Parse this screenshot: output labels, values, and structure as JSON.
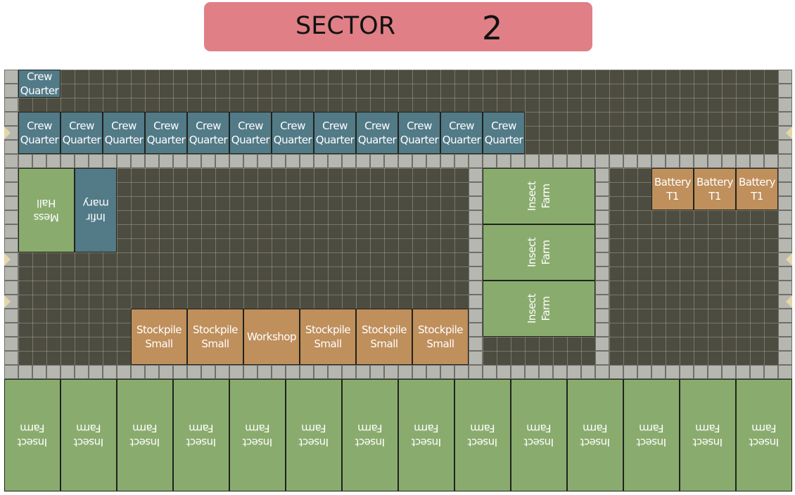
{
  "header": {
    "title": "SECTOR",
    "sector_number": "2",
    "color": "#e07f86"
  },
  "map": {
    "grid_columns": 56,
    "grid_rows": 30,
    "colors": {
      "floor": "#4d4c40",
      "corridor": "#b7b7b1",
      "blue_room": "#527a87",
      "green_room": "#8aab6e",
      "orange_room": "#bf8f5c",
      "marker": "#e6d6a8"
    },
    "rooms": [
      {
        "label": "Crew\nQuarter",
        "type": "crew-quarter",
        "color": "blue",
        "col": 1,
        "row": 0,
        "w": 3,
        "h": 2,
        "rot": 0
      },
      {
        "label": "Crew\nQuarter",
        "type": "crew-quarter",
        "color": "blue",
        "col": 1,
        "row": 3,
        "w": 3,
        "h": 3,
        "rot": 0
      },
      {
        "label": "Crew\nQuarter",
        "type": "crew-quarter",
        "color": "blue",
        "col": 4,
        "row": 3,
        "w": 3,
        "h": 3,
        "rot": 0
      },
      {
        "label": "Crew\nQuarter",
        "type": "crew-quarter",
        "color": "blue",
        "col": 7,
        "row": 3,
        "w": 3,
        "h": 3,
        "rot": 0
      },
      {
        "label": "Crew\nQuarter",
        "type": "crew-quarter",
        "color": "blue",
        "col": 10,
        "row": 3,
        "w": 3,
        "h": 3,
        "rot": 0
      },
      {
        "label": "Crew\nQuarter",
        "type": "crew-quarter",
        "color": "blue",
        "col": 13,
        "row": 3,
        "w": 3,
        "h": 3,
        "rot": 0
      },
      {
        "label": "Crew\nQuarter",
        "type": "crew-quarter",
        "color": "blue",
        "col": 16,
        "row": 3,
        "w": 3,
        "h": 3,
        "rot": 0
      },
      {
        "label": "Crew\nQuarter",
        "type": "crew-quarter",
        "color": "blue",
        "col": 19,
        "row": 3,
        "w": 3,
        "h": 3,
        "rot": 0
      },
      {
        "label": "Crew\nQuarter",
        "type": "crew-quarter",
        "color": "blue",
        "col": 22,
        "row": 3,
        "w": 3,
        "h": 3,
        "rot": 0
      },
      {
        "label": "Crew\nQuarter",
        "type": "crew-quarter",
        "color": "blue",
        "col": 25,
        "row": 3,
        "w": 3,
        "h": 3,
        "rot": 0
      },
      {
        "label": "Crew\nQuarter",
        "type": "crew-quarter",
        "color": "blue",
        "col": 28,
        "row": 3,
        "w": 3,
        "h": 3,
        "rot": 0
      },
      {
        "label": "Crew\nQuarter",
        "type": "crew-quarter",
        "color": "blue",
        "col": 31,
        "row": 3,
        "w": 3,
        "h": 3,
        "rot": 0
      },
      {
        "label": "Crew\nQuarter",
        "type": "crew-quarter",
        "color": "blue",
        "col": 34,
        "row": 3,
        "w": 3,
        "h": 3,
        "rot": 0
      },
      {
        "label": "Mess\nHall",
        "type": "mess-hall",
        "color": "green",
        "col": 1,
        "row": 7,
        "w": 4,
        "h": 6,
        "rot": 180
      },
      {
        "label": "Infir\nmary",
        "type": "infirmary",
        "color": "blue",
        "col": 5,
        "row": 7,
        "w": 3,
        "h": 6,
        "rot": 180
      },
      {
        "label": "Insect\nFarm",
        "type": "insect-farm",
        "color": "green",
        "col": 34,
        "row": 7,
        "w": 8,
        "h": 4,
        "rot": 270
      },
      {
        "label": "Insect\nFarm",
        "type": "insect-farm",
        "color": "green",
        "col": 34,
        "row": 11,
        "w": 8,
        "h": 4,
        "rot": 270
      },
      {
        "label": "Insect\nFarm",
        "type": "insect-farm",
        "color": "green",
        "col": 34,
        "row": 15,
        "w": 8,
        "h": 4,
        "rot": 270
      },
      {
        "label": "Battery\nT1",
        "type": "battery-t1",
        "color": "orange",
        "col": 46,
        "row": 7,
        "w": 3,
        "h": 3,
        "rot": 0
      },
      {
        "label": "Battery\nT1",
        "type": "battery-t1",
        "color": "orange",
        "col": 49,
        "row": 7,
        "w": 3,
        "h": 3,
        "rot": 0
      },
      {
        "label": "Battery\nT1",
        "type": "battery-t1",
        "color": "orange",
        "col": 52,
        "row": 7,
        "w": 3,
        "h": 3,
        "rot": 0
      },
      {
        "label": "Stockpile\nSmall",
        "type": "stockpile-small",
        "color": "orange",
        "col": 9,
        "row": 17,
        "w": 4,
        "h": 4,
        "rot": 0
      },
      {
        "label": "Stockpile\nSmall",
        "type": "stockpile-small",
        "color": "orange",
        "col": 13,
        "row": 17,
        "w": 4,
        "h": 4,
        "rot": 0
      },
      {
        "label": "Workshop",
        "type": "workshop",
        "color": "orange",
        "col": 17,
        "row": 17,
        "w": 4,
        "h": 4,
        "rot": 0
      },
      {
        "label": "Stockpile\nSmall",
        "type": "stockpile-small",
        "color": "orange",
        "col": 21,
        "row": 17,
        "w": 4,
        "h": 4,
        "rot": 0
      },
      {
        "label": "Stockpile\nSmall",
        "type": "stockpile-small",
        "color": "orange",
        "col": 25,
        "row": 17,
        "w": 4,
        "h": 4,
        "rot": 0
      },
      {
        "label": "Stockpile\nSmall",
        "type": "stockpile-small",
        "color": "orange",
        "col": 29,
        "row": 17,
        "w": 4,
        "h": 4,
        "rot": 0
      },
      {
        "label": "Insect\nFarm",
        "type": "insect-farm",
        "color": "green",
        "col": 0,
        "row": 22,
        "w": 4,
        "h": 8,
        "rot": 180
      },
      {
        "label": "Insect\nFarm",
        "type": "insect-farm",
        "color": "green",
        "col": 4,
        "row": 22,
        "w": 4,
        "h": 8,
        "rot": 180
      },
      {
        "label": "Insect\nFarm",
        "type": "insect-farm",
        "color": "green",
        "col": 8,
        "row": 22,
        "w": 4,
        "h": 8,
        "rot": 180
      },
      {
        "label": "Insect\nFarm",
        "type": "insect-farm",
        "color": "green",
        "col": 12,
        "row": 22,
        "w": 4,
        "h": 8,
        "rot": 180
      },
      {
        "label": "Insect\nFarm",
        "type": "insect-farm",
        "color": "green",
        "col": 16,
        "row": 22,
        "w": 4,
        "h": 8,
        "rot": 180
      },
      {
        "label": "Insect\nFarm",
        "type": "insect-farm",
        "color": "green",
        "col": 20,
        "row": 22,
        "w": 4,
        "h": 8,
        "rot": 180
      },
      {
        "label": "Insect\nFarm",
        "type": "insect-farm",
        "color": "green",
        "col": 24,
        "row": 22,
        "w": 4,
        "h": 8,
        "rot": 180
      },
      {
        "label": "Insect\nFarm",
        "type": "insect-farm",
        "color": "green",
        "col": 28,
        "row": 22,
        "w": 4,
        "h": 8,
        "rot": 180
      },
      {
        "label": "Insect\nFarm",
        "type": "insect-farm",
        "color": "green",
        "col": 32,
        "row": 22,
        "w": 4,
        "h": 8,
        "rot": 180
      },
      {
        "label": "Insect\nFarm",
        "type": "insect-farm",
        "color": "green",
        "col": 36,
        "row": 22,
        "w": 4,
        "h": 8,
        "rot": 180
      },
      {
        "label": "Insect\nFarm",
        "type": "insect-farm",
        "color": "green",
        "col": 40,
        "row": 22,
        "w": 4,
        "h": 8,
        "rot": 180
      },
      {
        "label": "Insect\nFarm",
        "type": "insect-farm",
        "color": "green",
        "col": 44,
        "row": 22,
        "w": 4,
        "h": 8,
        "rot": 180
      },
      {
        "label": "Insect\nFarm",
        "type": "insect-farm",
        "color": "green",
        "col": 48,
        "row": 22,
        "w": 4,
        "h": 8,
        "rot": 180
      },
      {
        "label": "Insect\nFarm",
        "type": "insect-farm",
        "color": "green",
        "col": 52,
        "row": 22,
        "w": 4,
        "h": 8,
        "rot": 180
      }
    ],
    "corridors": [
      {
        "orient": "v",
        "col": 0,
        "from": 0,
        "to": 21
      },
      {
        "orient": "v",
        "col": 55,
        "from": 0,
        "to": 21
      },
      {
        "orient": "h",
        "row": 6,
        "from": 0,
        "to": 55
      },
      {
        "orient": "h",
        "row": 21,
        "from": 0,
        "to": 55
      },
      {
        "orient": "v",
        "col": 33,
        "from": 7,
        "to": 20
      },
      {
        "orient": "v",
        "col": 42,
        "from": 7,
        "to": 20
      }
    ],
    "entrance_markers": [
      {
        "side": "left",
        "row": 4
      },
      {
        "side": "left",
        "row": 13
      },
      {
        "side": "left",
        "row": 16
      },
      {
        "side": "right",
        "row": 4
      },
      {
        "side": "right",
        "row": 13
      },
      {
        "side": "right",
        "row": 16
      }
    ]
  }
}
